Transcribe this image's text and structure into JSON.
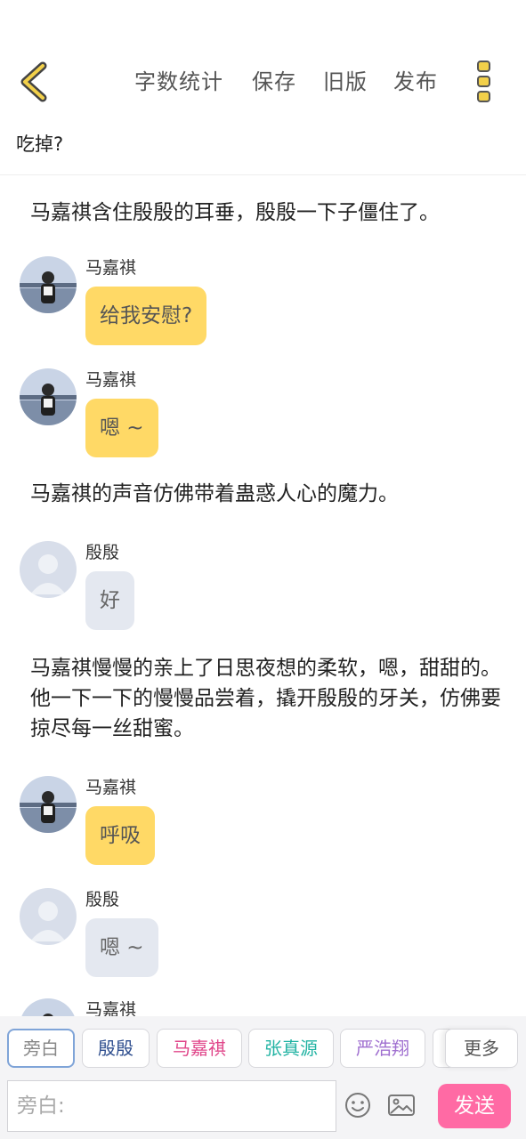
{
  "topbar": {
    "menu": [
      "字数统计",
      "保存",
      "旧版",
      "发布"
    ]
  },
  "title": "吃掉?",
  "story": {
    "n1": "马嘉祺含住殷殷的耳垂，殷殷一下子僵住了。",
    "m1": {
      "speaker": "马嘉祺",
      "text": "给我安慰?"
    },
    "m2": {
      "speaker": "马嘉祺",
      "text": "嗯 ~"
    },
    "n2": "马嘉祺的声音仿佛带着蛊惑人心的魔力。",
    "m3": {
      "speaker": "殷殷",
      "text": "好"
    },
    "n3": "马嘉祺慢慢的亲上了日思夜想的柔软，嗯，甜甜的。他一下一下的慢慢品尝着，撬开殷殷的牙关，仿佛要掠尽每一丝甜蜜。",
    "m4": {
      "speaker": "马嘉祺",
      "text": "呼吸"
    },
    "m5": {
      "speaker": "殷殷",
      "text": "嗯 ~"
    },
    "m6": {
      "speaker": "马嘉祺"
    }
  },
  "roles": [
    {
      "label": "旁白",
      "color": "#888888"
    },
    {
      "label": "殷殷",
      "color": "#2f4f8f"
    },
    {
      "label": "马嘉祺",
      "color": "#e0468a"
    },
    {
      "label": "张真源",
      "color": "#22b3a3"
    },
    {
      "label": "严浩翔",
      "color": "#a070d0"
    }
  ],
  "more_label": "更多",
  "input": {
    "placeholder": "旁白:"
  },
  "send_label": "发送",
  "colors": {
    "accent_yellow": "#ffd966",
    "send_pink": "#ff6aa4",
    "icon_yellow": "#f2d04a"
  }
}
